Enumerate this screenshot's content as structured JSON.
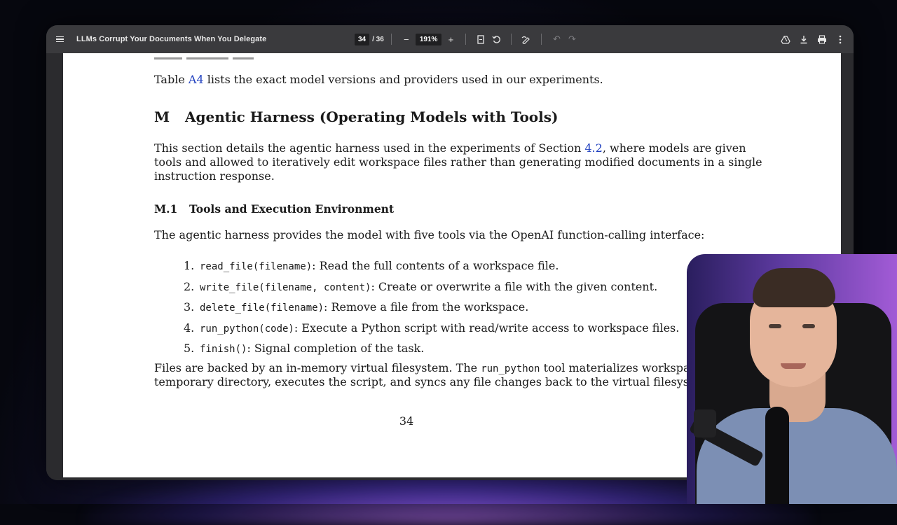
{
  "toolbar": {
    "doc_title": "LLMs Corrupt Your Documents When You Delegate",
    "current_page": "34",
    "page_separator": "/ 36",
    "zoom": "191%",
    "zoom_out": "−",
    "zoom_in": "+"
  },
  "page": {
    "intro_prefix": "Table ",
    "intro_link": "A4",
    "intro_suffix": " lists the exact model versions and providers used in our experiments.",
    "section_number": "M",
    "section_title": "Agentic Harness (Operating Models with Tools)",
    "section_para_prefix": "This section details the agentic harness used in the experiments of Section ",
    "section_para_link": "4.2",
    "section_para_line1_suffix": ", where models are given",
    "section_para_line2": "tools and allowed to iteratively edit workspace files rather than generating modified documents in a single",
    "section_para_line3": "instruction response.",
    "subsection_number": "M.1",
    "subsection_title": "Tools and Execution Environment",
    "tools_intro": "The agentic harness provides the model with five tools via the OpenAI function-calling interface:",
    "tools": [
      {
        "num": "1.",
        "code": "read_file(filename)",
        "desc": ": Read the full contents of a workspace file."
      },
      {
        "num": "2.",
        "code": "write_file(filename, content)",
        "desc": ": Create or overwrite a file with the given content."
      },
      {
        "num": "3.",
        "code": "delete_file(filename)",
        "desc": ": Remove a file from the workspace."
      },
      {
        "num": "4.",
        "code": "run_python(code)",
        "desc": ": Execute a Python script with read/write access to workspace files."
      },
      {
        "num": "5.",
        "code": "finish()",
        "desc": ": Signal completion of the task."
      }
    ],
    "files_line1_prefix": "Files are backed by an in-memory virtual filesystem. The ",
    "files_line1_code": "run_python",
    "files_line1_suffix": " tool materializes workspa",
    "files_line2": "temporary directory, executes the script, and syncs any file changes back to the virtual filesyste",
    "page_number": "34"
  }
}
